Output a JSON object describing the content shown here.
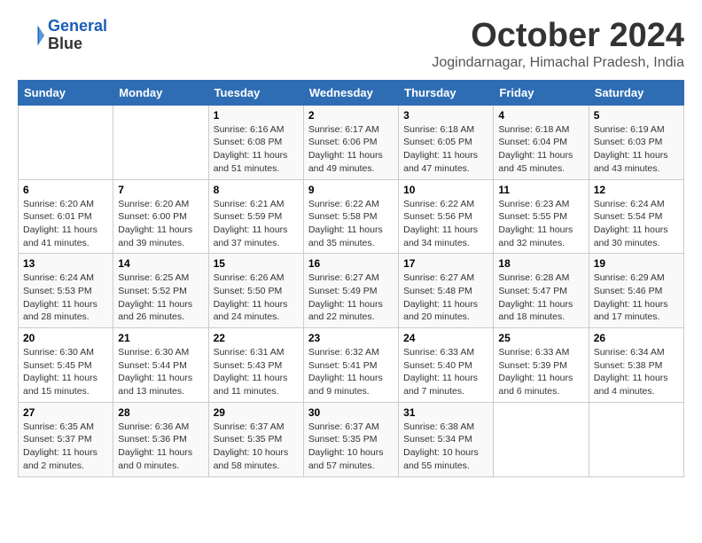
{
  "header": {
    "logo_line1": "General",
    "logo_line2": "Blue",
    "month": "October 2024",
    "location": "Jogindarnagar, Himachal Pradesh, India"
  },
  "weekdays": [
    "Sunday",
    "Monday",
    "Tuesday",
    "Wednesday",
    "Thursday",
    "Friday",
    "Saturday"
  ],
  "weeks": [
    [
      {
        "day": "",
        "info": ""
      },
      {
        "day": "",
        "info": ""
      },
      {
        "day": "1",
        "info": "Sunrise: 6:16 AM\nSunset: 6:08 PM\nDaylight: 11 hours and 51 minutes."
      },
      {
        "day": "2",
        "info": "Sunrise: 6:17 AM\nSunset: 6:06 PM\nDaylight: 11 hours and 49 minutes."
      },
      {
        "day": "3",
        "info": "Sunrise: 6:18 AM\nSunset: 6:05 PM\nDaylight: 11 hours and 47 minutes."
      },
      {
        "day": "4",
        "info": "Sunrise: 6:18 AM\nSunset: 6:04 PM\nDaylight: 11 hours and 45 minutes."
      },
      {
        "day": "5",
        "info": "Sunrise: 6:19 AM\nSunset: 6:03 PM\nDaylight: 11 hours and 43 minutes."
      }
    ],
    [
      {
        "day": "6",
        "info": "Sunrise: 6:20 AM\nSunset: 6:01 PM\nDaylight: 11 hours and 41 minutes."
      },
      {
        "day": "7",
        "info": "Sunrise: 6:20 AM\nSunset: 6:00 PM\nDaylight: 11 hours and 39 minutes."
      },
      {
        "day": "8",
        "info": "Sunrise: 6:21 AM\nSunset: 5:59 PM\nDaylight: 11 hours and 37 minutes."
      },
      {
        "day": "9",
        "info": "Sunrise: 6:22 AM\nSunset: 5:58 PM\nDaylight: 11 hours and 35 minutes."
      },
      {
        "day": "10",
        "info": "Sunrise: 6:22 AM\nSunset: 5:56 PM\nDaylight: 11 hours and 34 minutes."
      },
      {
        "day": "11",
        "info": "Sunrise: 6:23 AM\nSunset: 5:55 PM\nDaylight: 11 hours and 32 minutes."
      },
      {
        "day": "12",
        "info": "Sunrise: 6:24 AM\nSunset: 5:54 PM\nDaylight: 11 hours and 30 minutes."
      }
    ],
    [
      {
        "day": "13",
        "info": "Sunrise: 6:24 AM\nSunset: 5:53 PM\nDaylight: 11 hours and 28 minutes."
      },
      {
        "day": "14",
        "info": "Sunrise: 6:25 AM\nSunset: 5:52 PM\nDaylight: 11 hours and 26 minutes."
      },
      {
        "day": "15",
        "info": "Sunrise: 6:26 AM\nSunset: 5:50 PM\nDaylight: 11 hours and 24 minutes."
      },
      {
        "day": "16",
        "info": "Sunrise: 6:27 AM\nSunset: 5:49 PM\nDaylight: 11 hours and 22 minutes."
      },
      {
        "day": "17",
        "info": "Sunrise: 6:27 AM\nSunset: 5:48 PM\nDaylight: 11 hours and 20 minutes."
      },
      {
        "day": "18",
        "info": "Sunrise: 6:28 AM\nSunset: 5:47 PM\nDaylight: 11 hours and 18 minutes."
      },
      {
        "day": "19",
        "info": "Sunrise: 6:29 AM\nSunset: 5:46 PM\nDaylight: 11 hours and 17 minutes."
      }
    ],
    [
      {
        "day": "20",
        "info": "Sunrise: 6:30 AM\nSunset: 5:45 PM\nDaylight: 11 hours and 15 minutes."
      },
      {
        "day": "21",
        "info": "Sunrise: 6:30 AM\nSunset: 5:44 PM\nDaylight: 11 hours and 13 minutes."
      },
      {
        "day": "22",
        "info": "Sunrise: 6:31 AM\nSunset: 5:43 PM\nDaylight: 11 hours and 11 minutes."
      },
      {
        "day": "23",
        "info": "Sunrise: 6:32 AM\nSunset: 5:41 PM\nDaylight: 11 hours and 9 minutes."
      },
      {
        "day": "24",
        "info": "Sunrise: 6:33 AM\nSunset: 5:40 PM\nDaylight: 11 hours and 7 minutes."
      },
      {
        "day": "25",
        "info": "Sunrise: 6:33 AM\nSunset: 5:39 PM\nDaylight: 11 hours and 6 minutes."
      },
      {
        "day": "26",
        "info": "Sunrise: 6:34 AM\nSunset: 5:38 PM\nDaylight: 11 hours and 4 minutes."
      }
    ],
    [
      {
        "day": "27",
        "info": "Sunrise: 6:35 AM\nSunset: 5:37 PM\nDaylight: 11 hours and 2 minutes."
      },
      {
        "day": "28",
        "info": "Sunrise: 6:36 AM\nSunset: 5:36 PM\nDaylight: 11 hours and 0 minutes."
      },
      {
        "day": "29",
        "info": "Sunrise: 6:37 AM\nSunset: 5:35 PM\nDaylight: 10 hours and 58 minutes."
      },
      {
        "day": "30",
        "info": "Sunrise: 6:37 AM\nSunset: 5:35 PM\nDaylight: 10 hours and 57 minutes."
      },
      {
        "day": "31",
        "info": "Sunrise: 6:38 AM\nSunset: 5:34 PM\nDaylight: 10 hours and 55 minutes."
      },
      {
        "day": "",
        "info": ""
      },
      {
        "day": "",
        "info": ""
      }
    ]
  ]
}
